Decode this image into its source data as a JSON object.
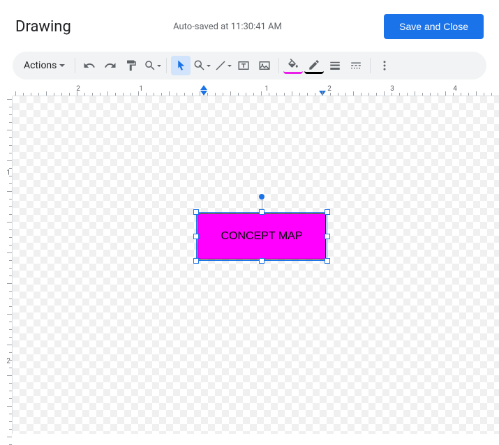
{
  "header": {
    "title": "Drawing",
    "status": "Auto-saved at 11:30:41 AM",
    "save_button": "Save and Close"
  },
  "toolbar": {
    "actions_label": "Actions"
  },
  "ruler": {
    "h_labels": [
      "2",
      "1",
      "1",
      "2",
      "3",
      "4"
    ],
    "v_labels": [
      "1",
      "2"
    ]
  },
  "shape": {
    "text": "CONCEPT MAP",
    "fill": "#ff00ff",
    "border": "#000000"
  }
}
